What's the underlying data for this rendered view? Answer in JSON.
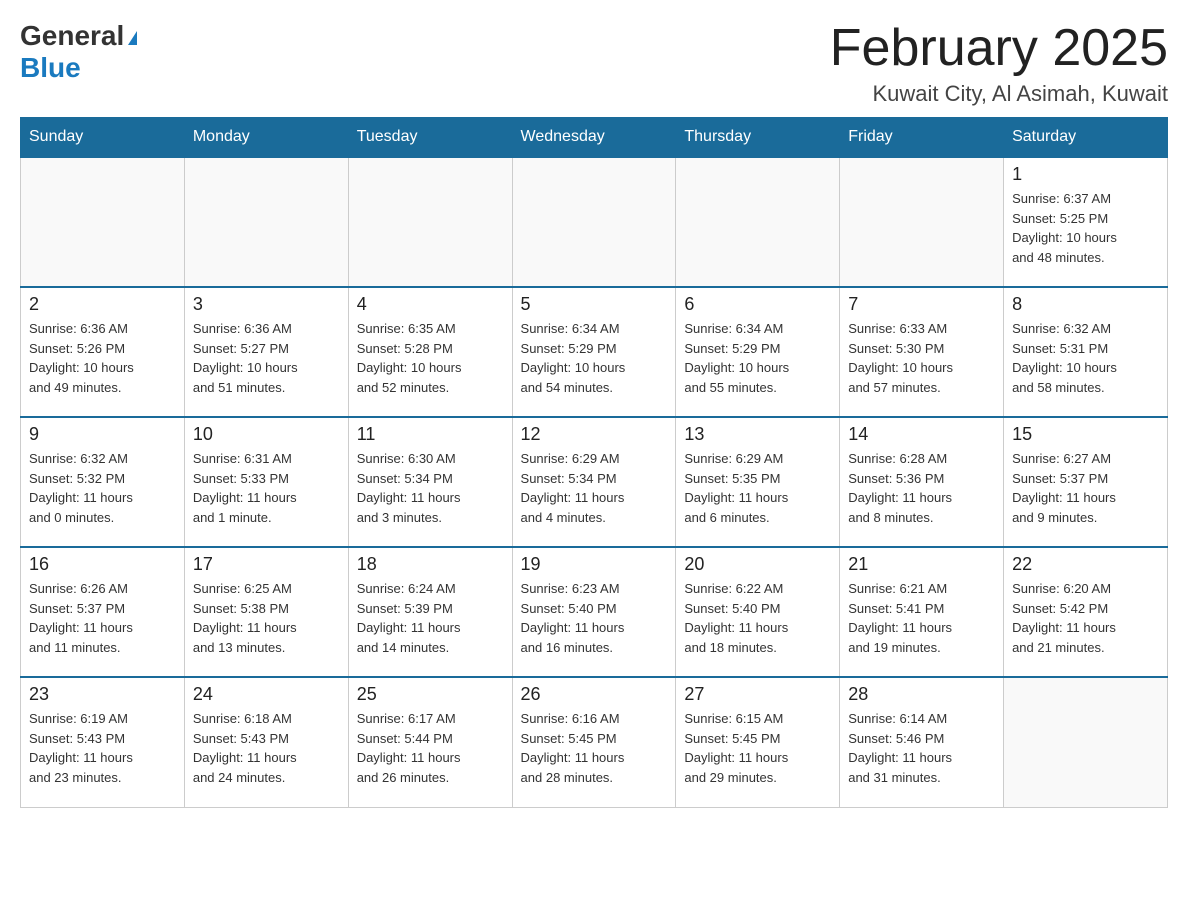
{
  "header": {
    "logo": {
      "general": "General",
      "blue": "Blue",
      "triangle": "▶"
    },
    "title": "February 2025",
    "location": "Kuwait City, Al Asimah, Kuwait"
  },
  "weekdays": [
    "Sunday",
    "Monday",
    "Tuesday",
    "Wednesday",
    "Thursday",
    "Friday",
    "Saturday"
  ],
  "weeks": [
    {
      "days": [
        {
          "number": "",
          "info": ""
        },
        {
          "number": "",
          "info": ""
        },
        {
          "number": "",
          "info": ""
        },
        {
          "number": "",
          "info": ""
        },
        {
          "number": "",
          "info": ""
        },
        {
          "number": "",
          "info": ""
        },
        {
          "number": "1",
          "info": "Sunrise: 6:37 AM\nSunset: 5:25 PM\nDaylight: 10 hours\nand 48 minutes."
        }
      ]
    },
    {
      "days": [
        {
          "number": "2",
          "info": "Sunrise: 6:36 AM\nSunset: 5:26 PM\nDaylight: 10 hours\nand 49 minutes."
        },
        {
          "number": "3",
          "info": "Sunrise: 6:36 AM\nSunset: 5:27 PM\nDaylight: 10 hours\nand 51 minutes."
        },
        {
          "number": "4",
          "info": "Sunrise: 6:35 AM\nSunset: 5:28 PM\nDaylight: 10 hours\nand 52 minutes."
        },
        {
          "number": "5",
          "info": "Sunrise: 6:34 AM\nSunset: 5:29 PM\nDaylight: 10 hours\nand 54 minutes."
        },
        {
          "number": "6",
          "info": "Sunrise: 6:34 AM\nSunset: 5:29 PM\nDaylight: 10 hours\nand 55 minutes."
        },
        {
          "number": "7",
          "info": "Sunrise: 6:33 AM\nSunset: 5:30 PM\nDaylight: 10 hours\nand 57 minutes."
        },
        {
          "number": "8",
          "info": "Sunrise: 6:32 AM\nSunset: 5:31 PM\nDaylight: 10 hours\nand 58 minutes."
        }
      ]
    },
    {
      "days": [
        {
          "number": "9",
          "info": "Sunrise: 6:32 AM\nSunset: 5:32 PM\nDaylight: 11 hours\nand 0 minutes."
        },
        {
          "number": "10",
          "info": "Sunrise: 6:31 AM\nSunset: 5:33 PM\nDaylight: 11 hours\nand 1 minute."
        },
        {
          "number": "11",
          "info": "Sunrise: 6:30 AM\nSunset: 5:34 PM\nDaylight: 11 hours\nand 3 minutes."
        },
        {
          "number": "12",
          "info": "Sunrise: 6:29 AM\nSunset: 5:34 PM\nDaylight: 11 hours\nand 4 minutes."
        },
        {
          "number": "13",
          "info": "Sunrise: 6:29 AM\nSunset: 5:35 PM\nDaylight: 11 hours\nand 6 minutes."
        },
        {
          "number": "14",
          "info": "Sunrise: 6:28 AM\nSunset: 5:36 PM\nDaylight: 11 hours\nand 8 minutes."
        },
        {
          "number": "15",
          "info": "Sunrise: 6:27 AM\nSunset: 5:37 PM\nDaylight: 11 hours\nand 9 minutes."
        }
      ]
    },
    {
      "days": [
        {
          "number": "16",
          "info": "Sunrise: 6:26 AM\nSunset: 5:37 PM\nDaylight: 11 hours\nand 11 minutes."
        },
        {
          "number": "17",
          "info": "Sunrise: 6:25 AM\nSunset: 5:38 PM\nDaylight: 11 hours\nand 13 minutes."
        },
        {
          "number": "18",
          "info": "Sunrise: 6:24 AM\nSunset: 5:39 PM\nDaylight: 11 hours\nand 14 minutes."
        },
        {
          "number": "19",
          "info": "Sunrise: 6:23 AM\nSunset: 5:40 PM\nDaylight: 11 hours\nand 16 minutes."
        },
        {
          "number": "20",
          "info": "Sunrise: 6:22 AM\nSunset: 5:40 PM\nDaylight: 11 hours\nand 18 minutes."
        },
        {
          "number": "21",
          "info": "Sunrise: 6:21 AM\nSunset: 5:41 PM\nDaylight: 11 hours\nand 19 minutes."
        },
        {
          "number": "22",
          "info": "Sunrise: 6:20 AM\nSunset: 5:42 PM\nDaylight: 11 hours\nand 21 minutes."
        }
      ]
    },
    {
      "days": [
        {
          "number": "23",
          "info": "Sunrise: 6:19 AM\nSunset: 5:43 PM\nDaylight: 11 hours\nand 23 minutes."
        },
        {
          "number": "24",
          "info": "Sunrise: 6:18 AM\nSunset: 5:43 PM\nDaylight: 11 hours\nand 24 minutes."
        },
        {
          "number": "25",
          "info": "Sunrise: 6:17 AM\nSunset: 5:44 PM\nDaylight: 11 hours\nand 26 minutes."
        },
        {
          "number": "26",
          "info": "Sunrise: 6:16 AM\nSunset: 5:45 PM\nDaylight: 11 hours\nand 28 minutes."
        },
        {
          "number": "27",
          "info": "Sunrise: 6:15 AM\nSunset: 5:45 PM\nDaylight: 11 hours\nand 29 minutes."
        },
        {
          "number": "28",
          "info": "Sunrise: 6:14 AM\nSunset: 5:46 PM\nDaylight: 11 hours\nand 31 minutes."
        },
        {
          "number": "",
          "info": ""
        }
      ]
    }
  ]
}
